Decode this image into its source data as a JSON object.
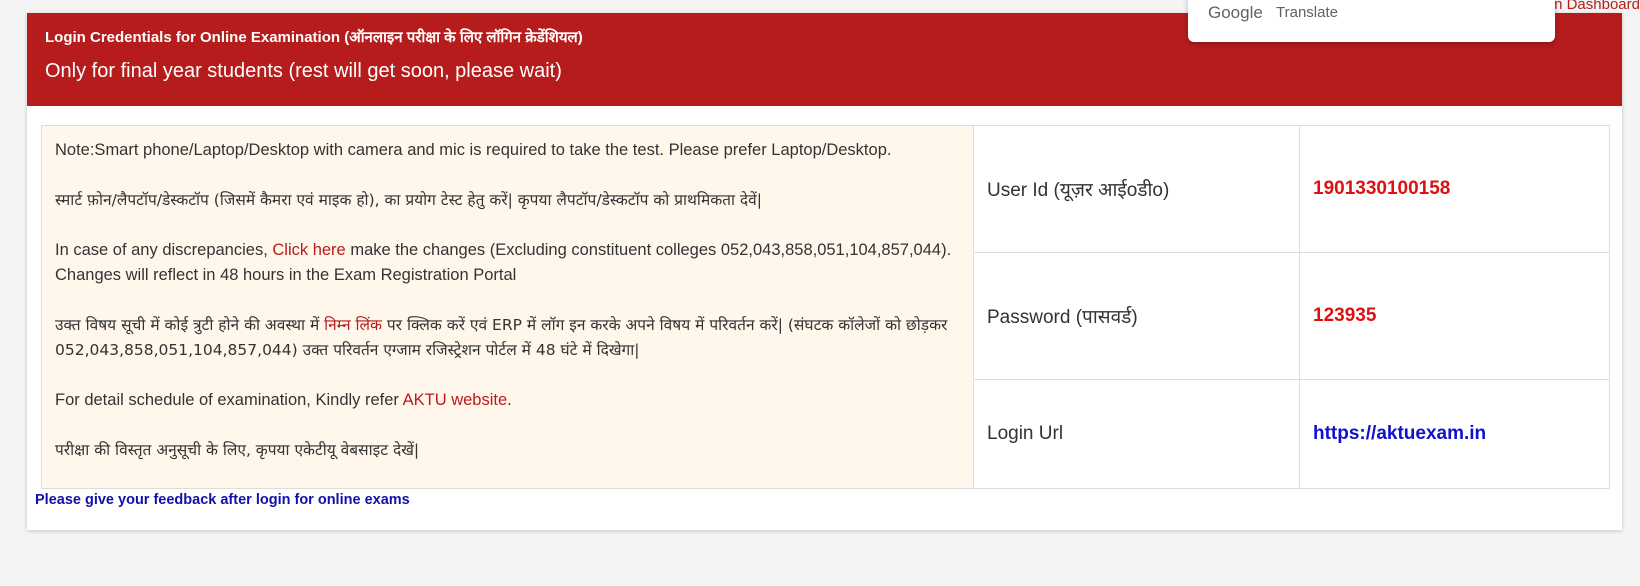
{
  "top_link": "n Dashboard",
  "google_translate": {
    "brand": "Google",
    "label": "Translate"
  },
  "header": {
    "title": "Login Credentials for Online Examination (ऑनलाइन परीक्षा के लिए लॉगिन क्रेडेंशियल)",
    "subtitle": "Only for final year students (rest will get soon, please wait)"
  },
  "notes": {
    "note_en": "Note:Smart phone/Laptop/Desktop with camera and mic is required to take the test. Please prefer Laptop/Desktop.",
    "note_hi": "स्मार्ट फ़ोन/लैपटॉप/डेस्कटॉप (जिसमें कैमरा एवं माइक हो), का प्रयोग टेस्ट हेतु करें| कृपया लैपटॉप/डेस्कटॉप को प्राथमिकता देवें|",
    "discrepancy_en_1": "In case of any discrepancies, ",
    "discrepancy_en_link": "Click here",
    "discrepancy_en_2": " make the changes (Excluding constituent colleges 052,043,858,051,104,857,044). Changes will reflect in 48 hours in the Exam Registration Portal",
    "discrepancy_hi_1": "उक्त विषय सूची में कोई त्रुटी होने की अवस्था में ",
    "discrepancy_hi_link": "निम्न लिंक",
    "discrepancy_hi_2": " पर क्लिक करें एवं ERP में लॉग इन करके अपने विषय में परिवर्तन करें| (संघटक कॉलेजों को छोड़कर 052,043,858,051,104,857,044) उक्त परिवर्तन एग्जाम रजिस्ट्रेशन पोर्टल में 48 घंटे में दिखेगा|",
    "schedule_en_1": "For detail schedule of examination, Kindly refer ",
    "schedule_en_link": "AKTU website",
    "schedule_en_2": ".",
    "schedule_hi": "परीक्षा की विस्तृत अनुसूची के लिए, कृपया एकेटीयू वेबसाइट देखें|"
  },
  "credentials": {
    "user_id_label": "User Id (यूज़र आईoडीo)",
    "user_id_value": "1901330100158",
    "password_label": "Password (पासवर्ड)",
    "password_value": "123935",
    "login_url_label": "Login Url",
    "login_url_value": "https://aktuexam.in"
  },
  "feedback_text": "Please give your feedback after login for online exams",
  "colors": {
    "header_bg": "#b71c1c",
    "note_bg": "#fff7ec",
    "credential_red": "#dd1111",
    "link_blue": "#1111cc"
  }
}
